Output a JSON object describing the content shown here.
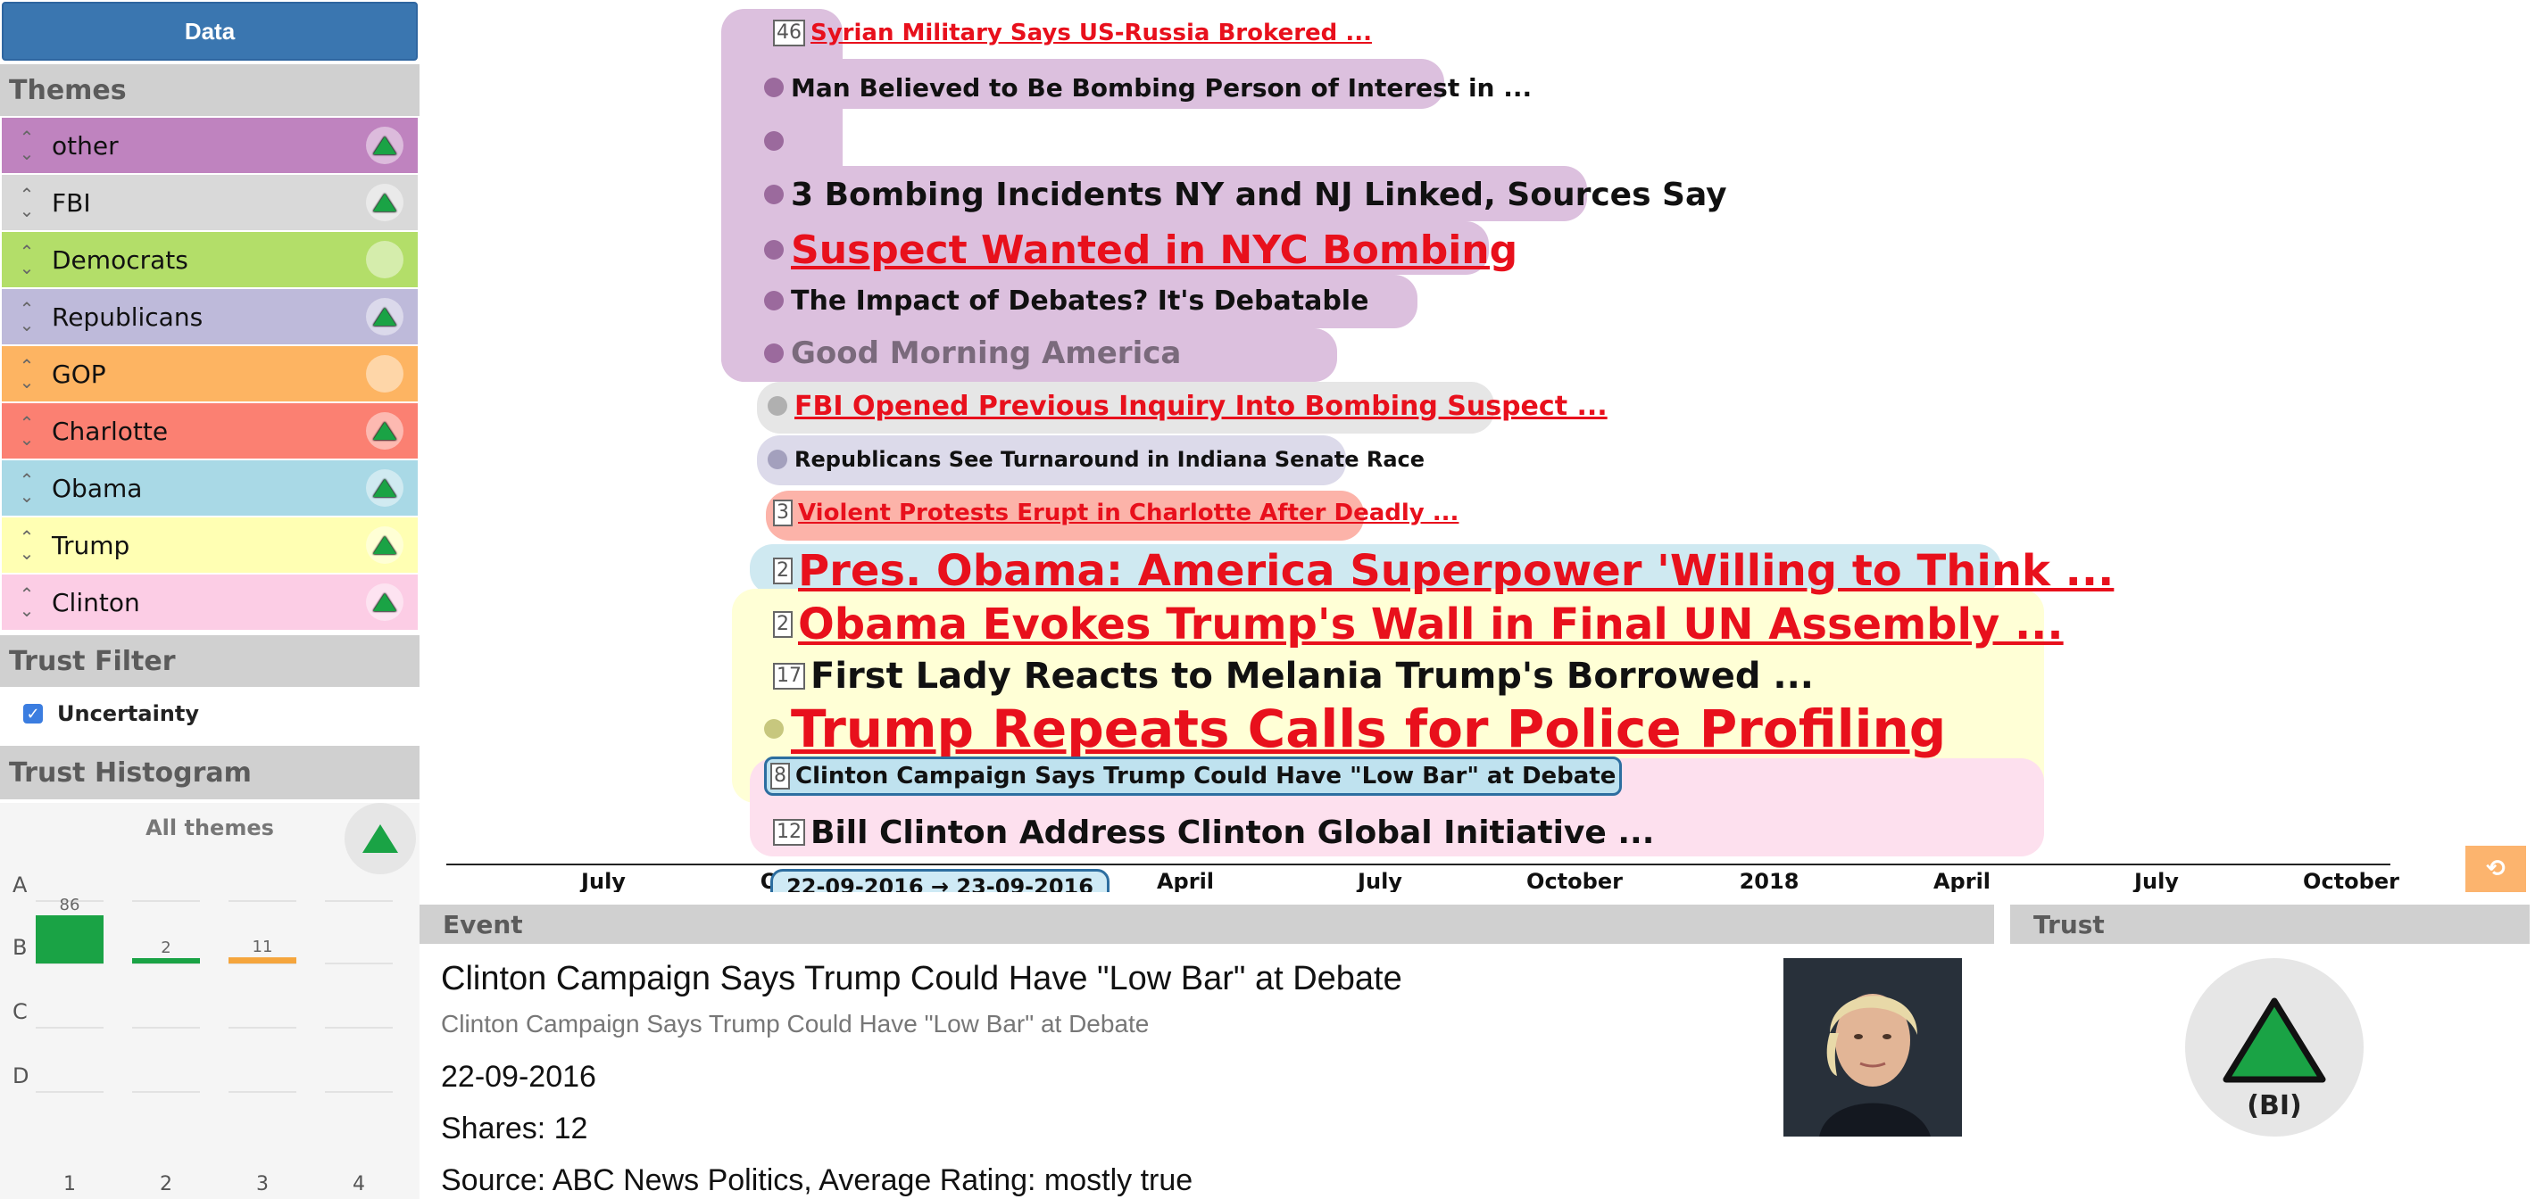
{
  "sidebar": {
    "data_button": "Data",
    "themes_header": "Themes",
    "themes": [
      {
        "name": "other",
        "color": "#bf83bf",
        "badge": "up"
      },
      {
        "name": "FBI",
        "color": "#d9d9d9",
        "badge": "up"
      },
      {
        "name": "Democrats",
        "color": "#b3de69",
        "badge": "none"
      },
      {
        "name": "Republicans",
        "color": "#bebada",
        "badge": "up"
      },
      {
        "name": "GOP",
        "color": "#fdb462",
        "badge": "none"
      },
      {
        "name": "Charlotte",
        "color": "#fb8072",
        "badge": "up"
      },
      {
        "name": "Obama",
        "color": "#a9d9e6",
        "badge": "up"
      },
      {
        "name": "Trump",
        "color": "#ffffb3",
        "badge": "up"
      },
      {
        "name": "Clinton",
        "color": "#fccde5",
        "badge": "up"
      }
    ],
    "trust_filter_header": "Trust Filter",
    "uncertainty_label": "Uncertainty",
    "uncertainty_checked": true,
    "trust_histogram_header": "Trust Histogram",
    "histogram": {
      "title": "All themes",
      "row_labels": [
        "A",
        "B",
        "C",
        "D"
      ],
      "col_labels": [
        "1",
        "2",
        "3",
        "4"
      ],
      "bars": [
        {
          "row": "B",
          "col": "1",
          "value": 86,
          "label": "86",
          "color": "#1aa345"
        },
        {
          "row": "B",
          "col": "2",
          "value": 2,
          "label": "2",
          "color": "#1aa345"
        },
        {
          "row": "B",
          "col": "3",
          "value": 11,
          "label": "11",
          "color": "#f5a53c"
        }
      ]
    }
  },
  "timeline": {
    "stories": [
      {
        "marker": "46",
        "text": "Syrian Military Says US-Russia Brokered ...",
        "style": "red"
      },
      {
        "marker": "dot",
        "text": "Man Believed to Be Bombing Person of Interest in ...",
        "style": "blk"
      },
      {
        "marker": "dot",
        "text": "",
        "style": "blk"
      },
      {
        "marker": "dot",
        "text": "3 Bombing Incidents NY and NJ Linked, Sources Say",
        "style": "blk"
      },
      {
        "marker": "dot",
        "text": "Suspect Wanted in NYC Bombing",
        "style": "red"
      },
      {
        "marker": "dot",
        "text": "The Impact of Debates? It's Debatable",
        "style": "blk"
      },
      {
        "marker": "dot",
        "text": "Good Morning America",
        "style": "grey"
      },
      {
        "marker": "dot",
        "text": "FBI Opened Previous Inquiry Into Bombing Suspect ...",
        "style": "red"
      },
      {
        "marker": "dot",
        "text": "Republicans See Turnaround in Indiana Senate Race",
        "style": "blk"
      },
      {
        "marker": "3",
        "text": "Violent Protests Erupt in Charlotte After Deadly ...",
        "style": "red"
      },
      {
        "marker": "2",
        "text": "Pres. Obama: America Superpower 'Willing to Think ...",
        "style": "red"
      },
      {
        "marker": "2",
        "text": "Obama Evokes Trump's Wall in Final UN Assembly ...",
        "style": "red"
      },
      {
        "marker": "17",
        "text": "First Lady Reacts to Melania Trump's Borrowed ...",
        "style": "blk"
      },
      {
        "marker": "dot",
        "text": "Trump Repeats Calls for Police Profiling",
        "style": "red"
      },
      {
        "marker": "8",
        "text": "Clinton Campaign Says Trump Could Have \"Low Bar\" at Debate",
        "style": "blk"
      },
      {
        "marker": "12",
        "text": "Bill Clinton Address Clinton Global Initiative ...",
        "style": "blk"
      }
    ],
    "axis_ticks": [
      "July",
      "O",
      "April",
      "July",
      "October",
      "2018",
      "April",
      "July",
      "October"
    ],
    "selected_range": "22-09-2016 → 23-09-2016",
    "refresh_icon": "refresh-icon"
  },
  "event": {
    "header": "Event",
    "title": "Clinton Campaign Says Trump Could Have \"Low Bar\" at Debate",
    "subtitle": "Clinton Campaign Says Trump Could Have \"Low Bar\" at Debate",
    "date": "22-09-2016",
    "shares": "Shares: 12",
    "source": "Source: ABC News Politics, Average Rating: mostly true"
  },
  "trust": {
    "header": "Trust",
    "rating": "(BI)",
    "color": "#1aa345"
  }
}
